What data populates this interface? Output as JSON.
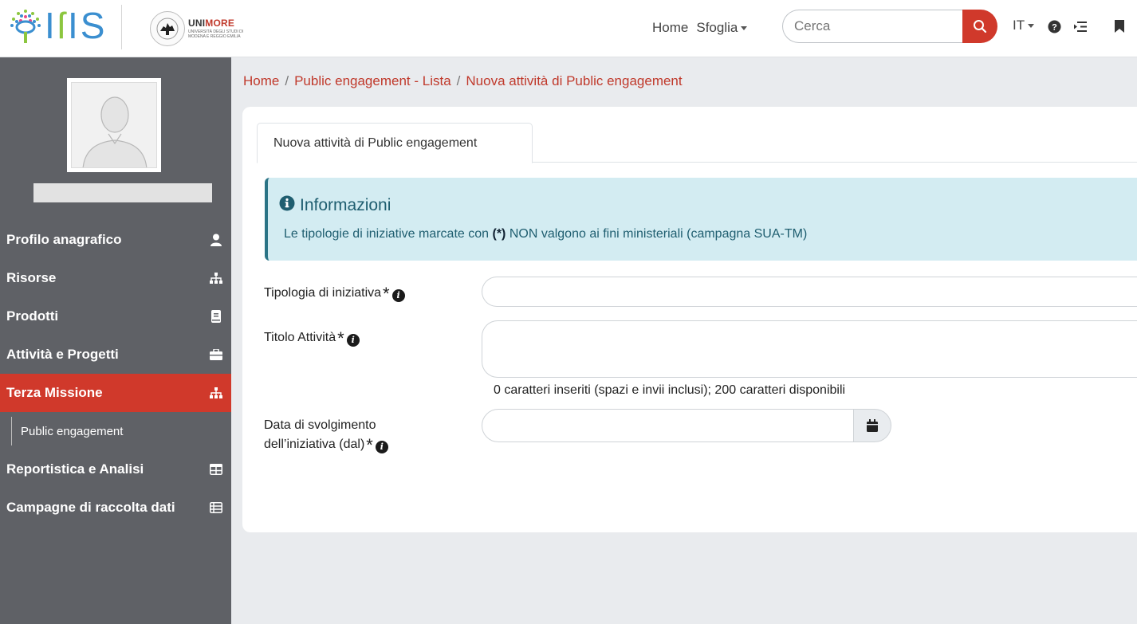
{
  "brand": {
    "logo_text": "IRIS",
    "university": "UNIMORE",
    "university_sub": "UNIVERSITÀ DEGLI STUDI DI MODENA E REGGIO EMILIA"
  },
  "nav": {
    "home": "Home",
    "browse": "Sfoglia",
    "search_placeholder": "Cerca",
    "language": "IT"
  },
  "sidebar": {
    "items": [
      {
        "label": "Profilo anagrafico",
        "icon": "user-icon"
      },
      {
        "label": "Risorse",
        "icon": "sitemap-icon"
      },
      {
        "label": "Prodotti",
        "icon": "book-icon"
      },
      {
        "label": "Attività e Progetti",
        "icon": "briefcase-icon"
      },
      {
        "label": "Terza Missione",
        "icon": "sitemap-icon",
        "active": true
      },
      {
        "label": "Reportistica e Analisi",
        "icon": "table-icon"
      },
      {
        "label": "Campagne di raccolta dati",
        "icon": "list-table-icon"
      }
    ],
    "sub_items": [
      {
        "label": "Public engagement"
      }
    ]
  },
  "breadcrumb": [
    "Home",
    "Public engagement - Lista",
    "Nuova attività di Public engagement"
  ],
  "tab": {
    "label": "Nuova attività di Public engagement"
  },
  "alert": {
    "title": "Informazioni",
    "text_before": "Le tipologie di iniziative marcate con ",
    "text_bold": "(*)",
    "text_after": " NON valgono ai fini ministeriali (campagna SUA-TM)"
  },
  "form": {
    "tipologia_label": "Tipologia di iniziativa",
    "titolo_label": "Titolo Attività",
    "counter": "0 caratteri inseriti (spazi e invii inclusi); 200 caratteri disponibili",
    "data_label_line1": "Data di svolgimento",
    "data_label_line2": "dell’iniziativa (dal)",
    "required_mark": "*"
  },
  "colors": {
    "accent": "#d0392b",
    "sidebar": "#5f6166",
    "info_bg": "#d3ecf2",
    "info_text": "#1f5e70"
  }
}
